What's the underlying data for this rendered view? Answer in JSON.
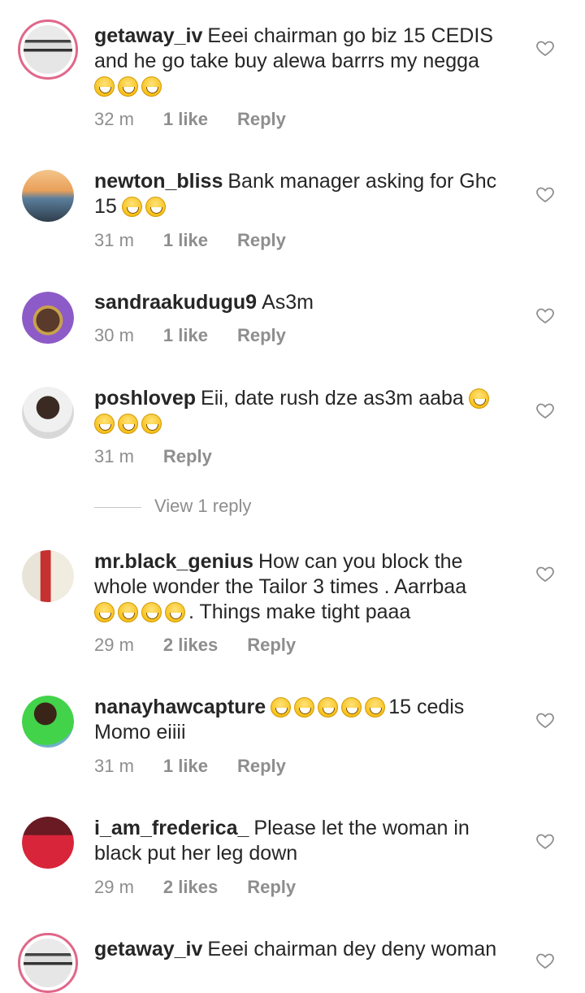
{
  "comments": [
    {
      "user": "getaway_iv",
      "text": "Eeei chairman go biz 15 CEDIS and he go take buy alewa  barrrs my negga",
      "emoji_count": 3,
      "emoji_tail": "",
      "time": "32 m",
      "likes": "1 like",
      "reply": "Reply"
    },
    {
      "user": "newton_bliss",
      "text": "Bank manager asking for Ghc 15",
      "emoji_count": 2,
      "emoji_tail": "",
      "time": "31 m",
      "likes": "1 like",
      "reply": "Reply"
    },
    {
      "user": "sandraakudugu9",
      "text": "As3m",
      "emoji_count": 0,
      "emoji_tail": "",
      "time": "30 m",
      "likes": "1 like",
      "reply": "Reply"
    },
    {
      "user": "poshlovep",
      "text": "Eii, date rush dze as3m aaba",
      "emoji_count": 4,
      "emoji_tail": "",
      "time": "31 m",
      "likes": "",
      "reply": "Reply"
    },
    {
      "user": "mr.black_genius",
      "text": "How can you block the whole wonder the Tailor 3 times .  Aarrbaa",
      "emoji_count": 4,
      "emoji_tail": ". Things make tight paaa",
      "time": "29 m",
      "likes": "2 likes",
      "reply": "Reply"
    },
    {
      "user": "nanayhawcapture",
      "text": "",
      "emoji_count": 5,
      "emoji_tail": "15 cedis Momo eiiii",
      "time": "31 m",
      "likes": "1 like",
      "reply": "Reply"
    },
    {
      "user": "i_am_frederica_",
      "text": "Please let the woman in black put her leg down",
      "emoji_count": 0,
      "emoji_tail": "",
      "time": "29 m",
      "likes": "2 likes",
      "reply": "Reply"
    },
    {
      "user": "getaway_iv",
      "text": "Eeei chairman dey deny woman",
      "emoji_count": 0,
      "emoji_tail": "",
      "time": "",
      "likes": "",
      "reply": ""
    }
  ],
  "view_replies": "View 1 reply",
  "icons": {
    "like": "heart-outline-icon"
  }
}
